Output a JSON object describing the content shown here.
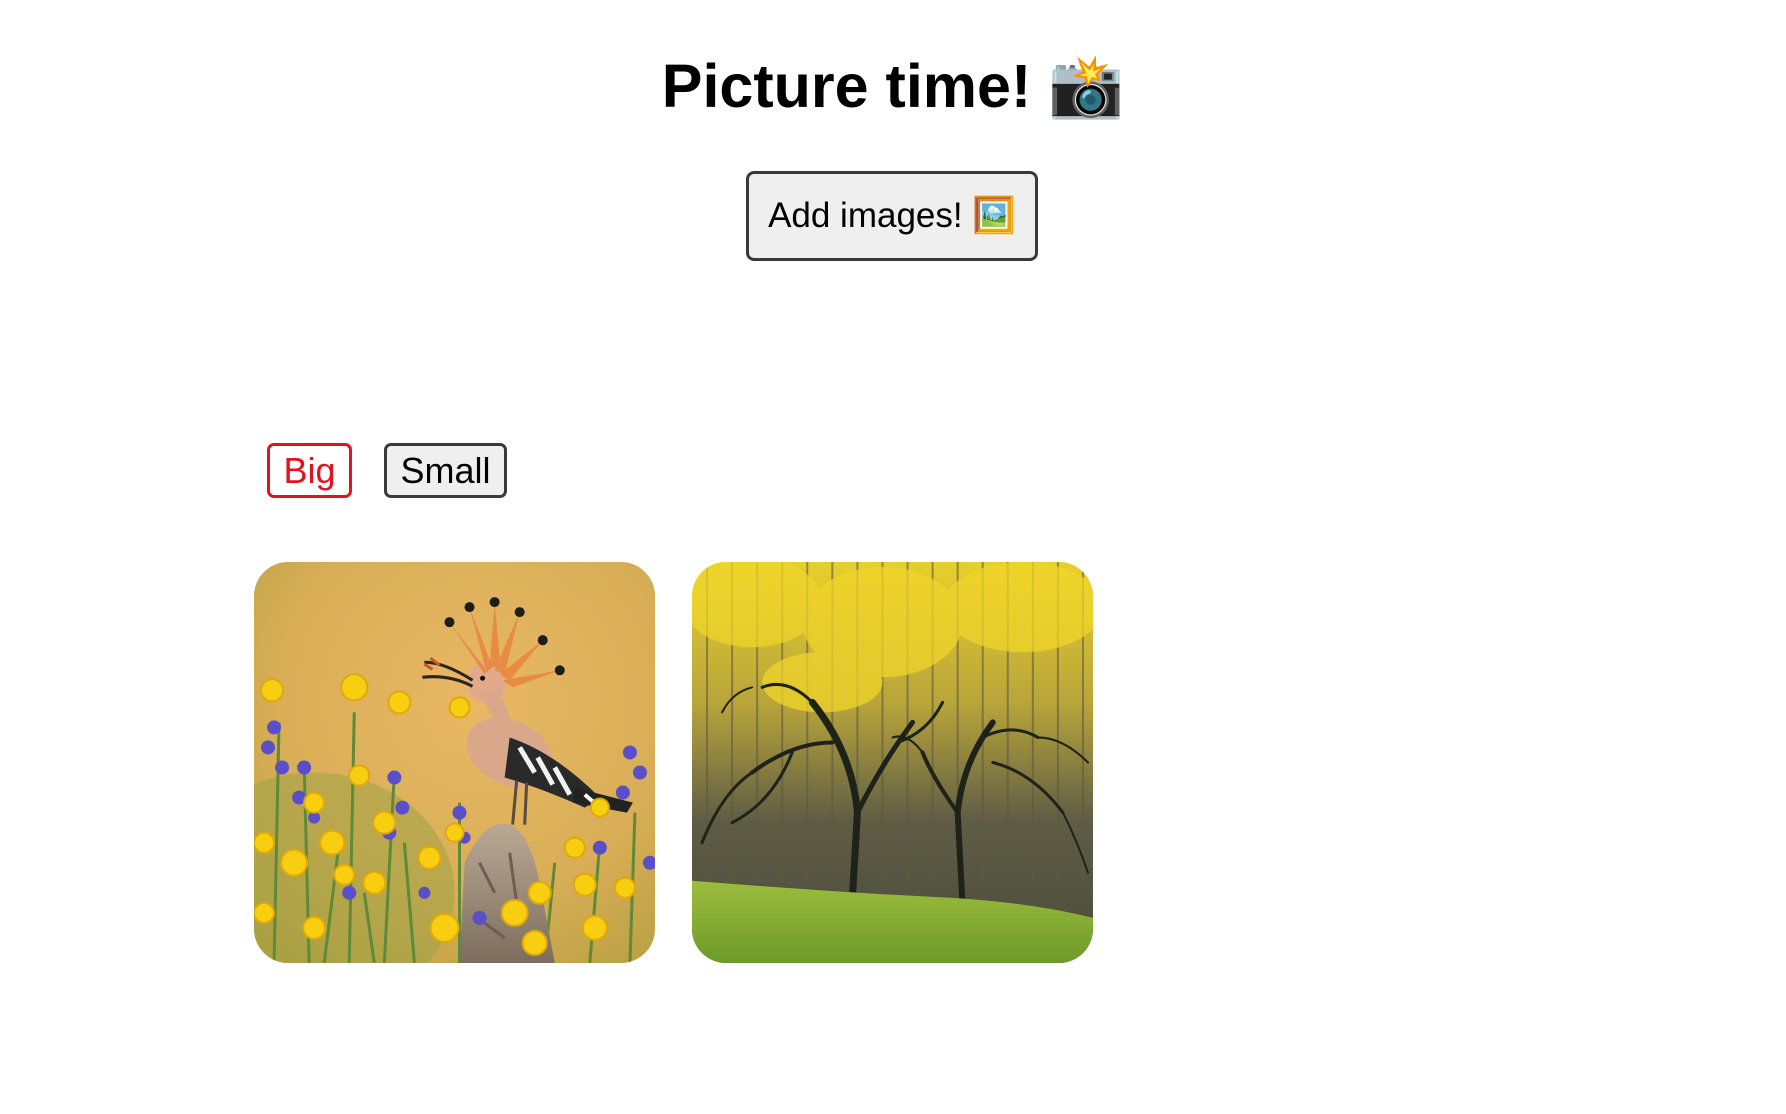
{
  "header": {
    "title": "Picture time! 📸"
  },
  "toolbar": {
    "add_images_label": "Add images! 🖼️"
  },
  "size_toggle": {
    "big_label": "Big",
    "small_label": "Small",
    "selected": "Big",
    "selected_color": "#e0131f"
  },
  "gallery": {
    "images": [
      {
        "subject": "hoopoe bird on a rock among yellow and purple wildflowers"
      },
      {
        "subject": "bare trees in front of a yellow autumn forest above a green meadow"
      }
    ]
  }
}
